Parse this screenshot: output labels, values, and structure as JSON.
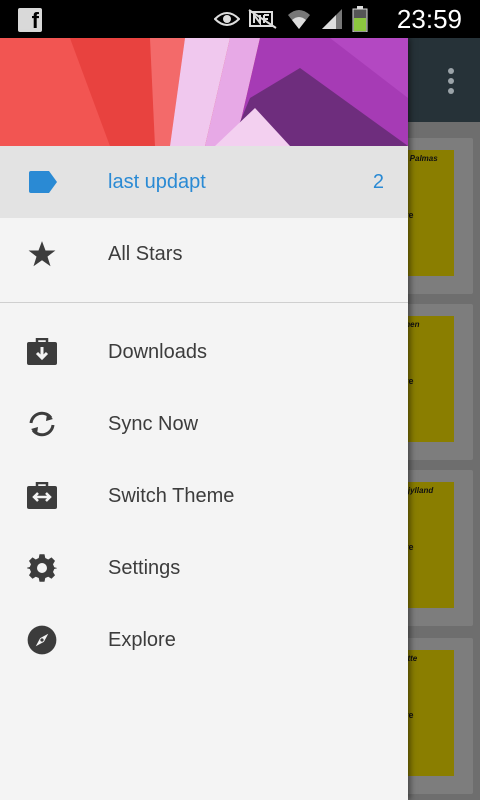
{
  "status_bar": {
    "time": "23:59",
    "icons": [
      "facebook-icon",
      "eye-icon",
      "nfc-icon",
      "wifi-icon",
      "signal-icon",
      "battery-icon"
    ]
  },
  "drawer": {
    "items": [
      {
        "label": "last updapt",
        "count": "2",
        "icon": "label-tag-icon",
        "selected": true
      },
      {
        "label": "All Stars",
        "icon": "star-icon"
      },
      {
        "label": "Downloads",
        "icon": "download-briefcase-icon"
      },
      {
        "label": "Sync Now",
        "icon": "sync-icon"
      },
      {
        "label": "Switch Theme",
        "icon": "switch-theme-icon"
      },
      {
        "label": "Settings",
        "icon": "gear-icon"
      },
      {
        "label": "Explore",
        "icon": "compass-icon"
      }
    ]
  },
  "background_cards": [
    {
      "title": "s Palmas",
      "action": "re"
    },
    {
      "title": "men",
      "action": "re"
    },
    {
      "title": "itjylland",
      "action": "re"
    },
    {
      "title": "ette",
      "action": "re"
    }
  ],
  "colors": {
    "accent": "#2a8ad4",
    "drawer_bg": "#f4f4f4",
    "selected_bg": "#e3e3e3",
    "toolbar_bg": "#263238",
    "card_yellow": "#8a7e00"
  }
}
